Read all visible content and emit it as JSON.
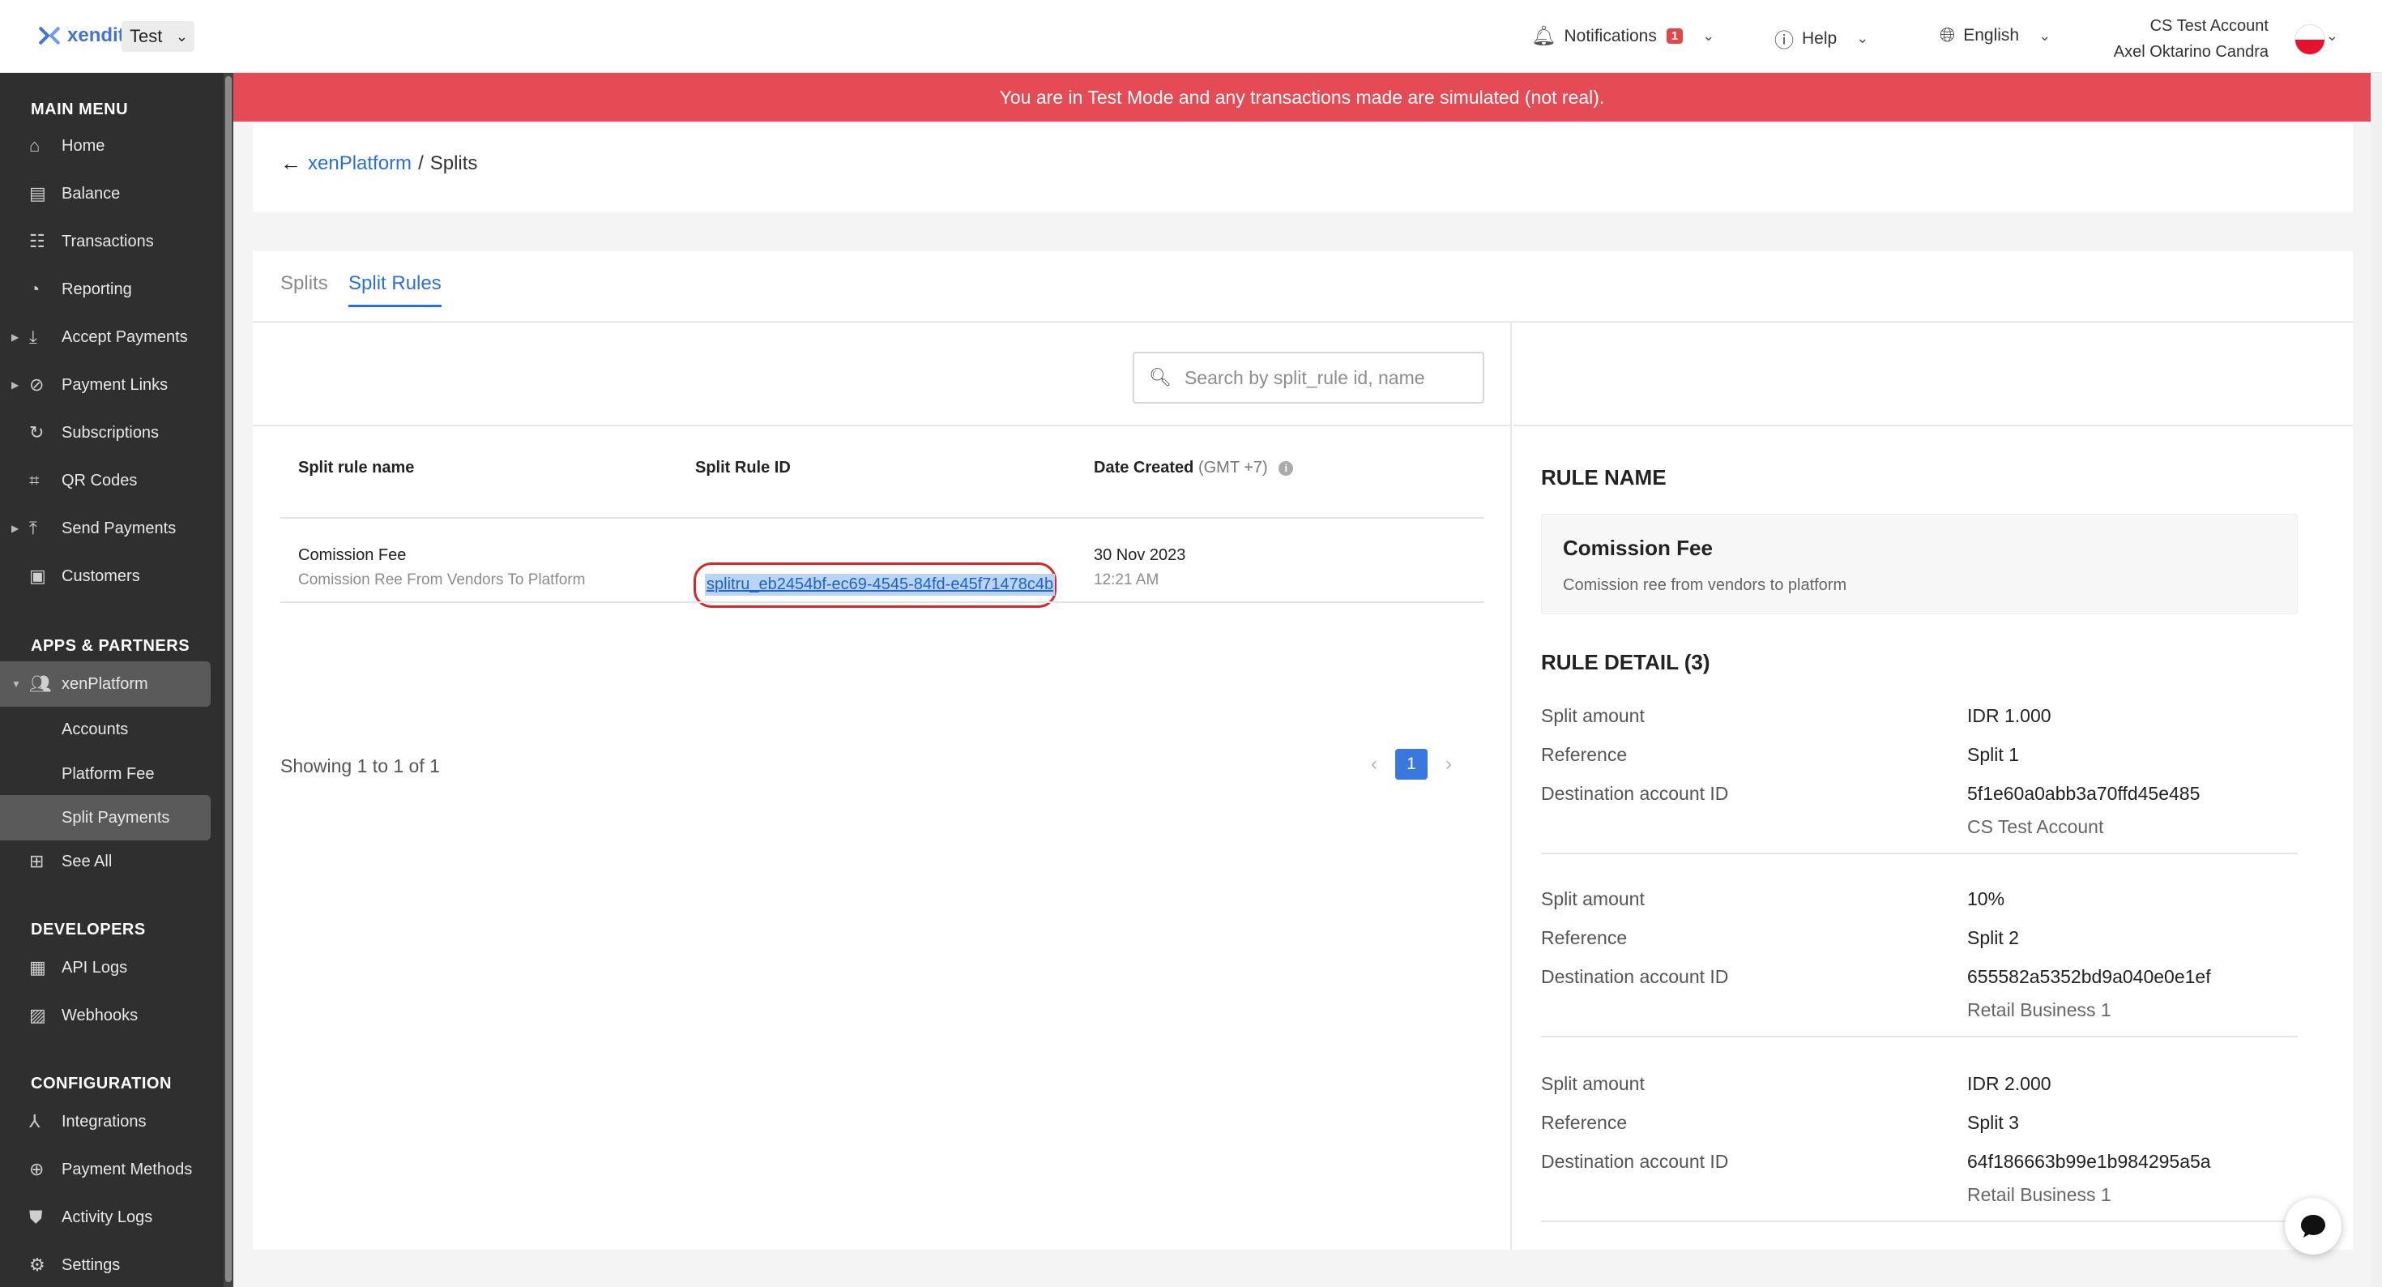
{
  "topbar": {
    "logo_text": "xendit",
    "env_value": "Test",
    "notifications_label": "Notifications",
    "notifications_count": "1",
    "help_label": "Help",
    "language_label": "English",
    "account_name": "CS Test Account",
    "user_name": "Axel Oktarino Candra"
  },
  "banner": {
    "text": "You are in Test Mode and any transactions made are simulated (not real)."
  },
  "sidebar": {
    "main_menu_title": "MAIN MENU",
    "main_items": [
      "Home",
      "Balance",
      "Transactions",
      "Reporting",
      "Accept Payments",
      "Payment Links",
      "Subscriptions",
      "QR Codes",
      "Send Payments",
      "Customers"
    ],
    "apps_title": "APPS & PARTNERS",
    "apps_items": [
      "xenPlatform",
      "Accounts",
      "Platform Fee",
      "Split Payments",
      "See All"
    ],
    "developers_title": "DEVELOPERS",
    "developers_items": [
      "API Logs",
      "Webhooks"
    ],
    "config_title": "CONFIGURATION",
    "config_items": [
      "Integrations",
      "Payment Methods",
      "Activity Logs",
      "Settings"
    ]
  },
  "breadcrumb": {
    "link": "xenPlatform",
    "separator": "/",
    "current": "Splits"
  },
  "tabs": [
    {
      "label": "Splits",
      "active": false
    },
    {
      "label": "Split Rules",
      "active": true
    }
  ],
  "search": {
    "placeholder": "Search by split_rule id, name",
    "value": ""
  },
  "table": {
    "headers": {
      "name": "Split rule name",
      "id": "Split Rule ID",
      "date": "Date Created",
      "date_tz": "(GMT +7)"
    },
    "rows": [
      {
        "name": "Comission Fee",
        "description": "Comission Ree From Vendors To Platform",
        "id": "splitru_eb2454bf-ec69-4545-84fd-e45f71478c4b",
        "date": "30 Nov 2023",
        "time": "12:21 AM"
      }
    ]
  },
  "pagination": {
    "showing": "Showing 1 to 1 of 1",
    "current_page": "1"
  },
  "detail": {
    "rule_name_heading": "RULE NAME",
    "rule_name": "Comission Fee",
    "rule_description": "Comission ree from vendors to platform",
    "rule_detail_heading": "RULE DETAIL (3)",
    "labels": {
      "amount": "Split amount",
      "reference": "Reference",
      "destination": "Destination account ID"
    },
    "splits": [
      {
        "amount": "IDR 1.000",
        "reference": "Split 1",
        "destination_id": "5f1e60a0abb3a70ffd45e485",
        "destination_name": "CS Test Account"
      },
      {
        "amount": "10%",
        "reference": "Split 2",
        "destination_id": "655582a5352bd9a040e0e1ef",
        "destination_name": "Retail Business 1"
      },
      {
        "amount": "IDR 2.000",
        "reference": "Split 3",
        "destination_id": "64f186663b99e1b984295a5a",
        "destination_name": "Retail Business 1"
      }
    ]
  },
  "colors": {
    "accent": "#2a6fdb",
    "banner": "#e44b55",
    "sidebar": "#2f2f2f",
    "highlight_circle": "#d9262a"
  }
}
